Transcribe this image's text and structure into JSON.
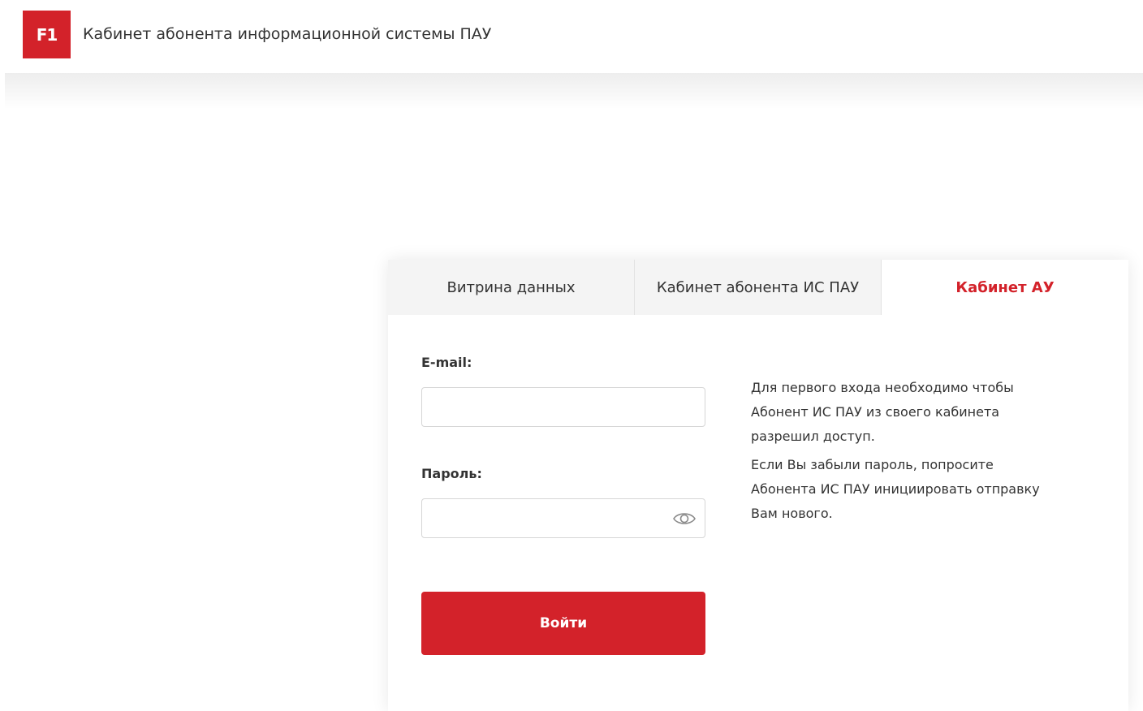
{
  "header": {
    "logo_text": "F1",
    "logo_color": "#d3222a",
    "title": "Кабинет абонента информационной системы ПАУ"
  },
  "tabs": [
    {
      "label": "Витрина данных",
      "active": false
    },
    {
      "label": "Кабинет абонента ИС ПАУ",
      "active": false
    },
    {
      "label": "Кабинет АУ",
      "active": true
    }
  ],
  "form": {
    "email_label": "E-mail:",
    "email_value": "",
    "password_label": "Пароль:",
    "password_value": "",
    "password_toggle_icon": "eye-icon",
    "submit_label": "Войти",
    "accent_color": "#d3222a"
  },
  "info": {
    "paragraph1_line1": "Для первого входа необходимо чтобы",
    "paragraph1_line2": "Абонент ИС ПАУ из своего кабинета",
    "paragraph1_line3": "разрешил доступ.",
    "paragraph2_line1": "Если Вы забыли пароль, попросите",
    "paragraph2_line2": "Абонента ИС ПАУ инициировать отправку",
    "paragraph2_line3": "Вам нового."
  }
}
